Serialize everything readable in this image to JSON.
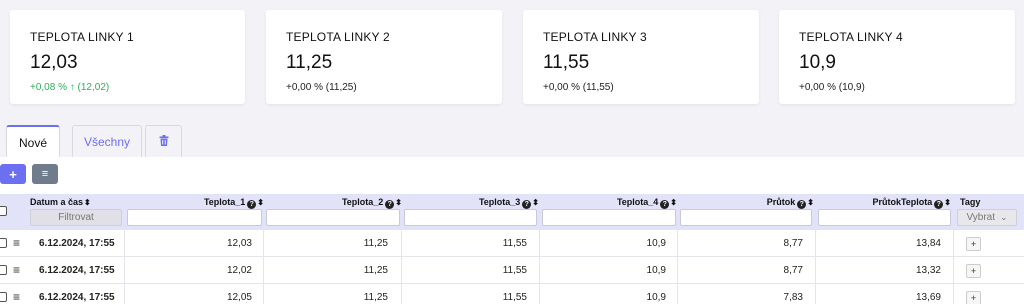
{
  "cards": [
    {
      "title": "TEPLOTA LINKY 1",
      "value": "12,03",
      "delta": "+0,08 % ↑ (12,02)"
    },
    {
      "title": "TEPLOTA LINKY 2",
      "value": "11,25",
      "delta": "+0,00 % (11,25)"
    },
    {
      "title": "TEPLOTA LINKY 3",
      "value": "11,55",
      "delta": "+0,00 % (11,55)"
    },
    {
      "title": "TEPLOTA LINKY 4",
      "value": "10,9",
      "delta": "+0,00 % (10,9)"
    }
  ],
  "colors": {
    "accent": "#6c6ff0",
    "positive": "#2fae57",
    "header_bg": "#e2e2f8"
  },
  "tabs": {
    "new": "Nové",
    "all": "Všechny",
    "trash_icon": "trash-icon"
  },
  "toolbar": {
    "add": "+",
    "menu": "≡"
  },
  "table": {
    "headers": {
      "date": "Datum a čas",
      "t1": "Teplota_1",
      "t2": "Teplota_2",
      "t3": "Teplota_3",
      "t4": "Teplota_4",
      "flow": "Průtok",
      "flow_temp": "PrůtokTeplota",
      "tags": "Tagy"
    },
    "help": "?",
    "sort": "⬍",
    "filter_label": "Filtrovat",
    "tags_select": "Vybrat",
    "tags_chevron": "⌄",
    "row_menu": "≡",
    "tag_add": "+",
    "rows": [
      {
        "date": "6.12.2024, 17:55",
        "t1": "12,03",
        "t2": "11,25",
        "t3": "11,55",
        "t4": "10,9",
        "flow": "8,77",
        "flow_temp": "13,84"
      },
      {
        "date": "6.12.2024, 17:55",
        "t1": "12,02",
        "t2": "11,25",
        "t3": "11,55",
        "t4": "10,9",
        "flow": "8,77",
        "flow_temp": "13,32"
      },
      {
        "date": "6.12.2024, 17:55",
        "t1": "12,05",
        "t2": "11,25",
        "t3": "11,55",
        "t4": "10,9",
        "flow": "7,83",
        "flow_temp": "13,69"
      }
    ]
  }
}
